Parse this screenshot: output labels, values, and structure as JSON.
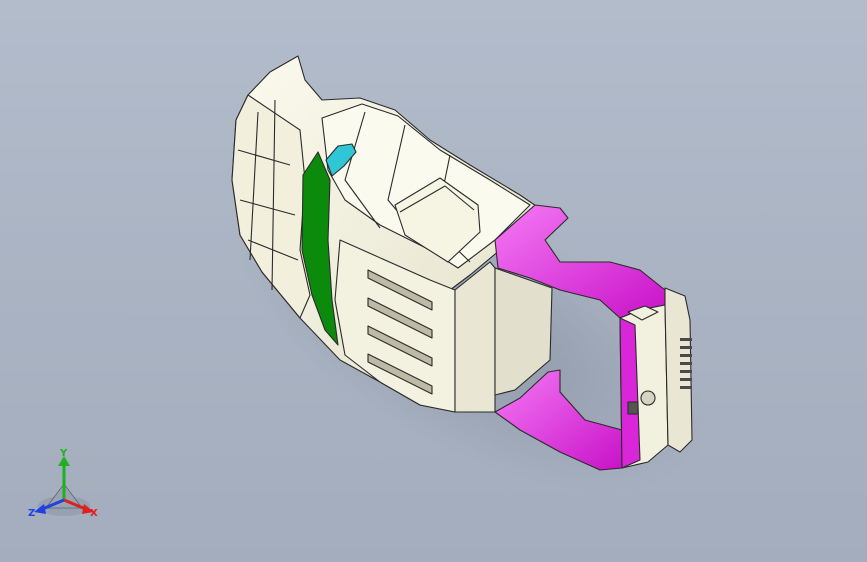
{
  "viewport": {
    "background_top": "#b3bccb",
    "background_bottom": "#a3adbd"
  },
  "model": {
    "body_color": "#f2f0df",
    "edge_color": "#2b2b2b",
    "door_panel_color": "#0c8a0c",
    "frame_color": "#e01ee0",
    "frame_highlight": "#f46af4",
    "mirror_color": "#2fc7d6"
  },
  "triad": {
    "x_label": "X",
    "y_label": "Y",
    "z_label": "Z",
    "x_color": "#e02020",
    "y_color": "#20b020",
    "z_color": "#2040e0"
  }
}
